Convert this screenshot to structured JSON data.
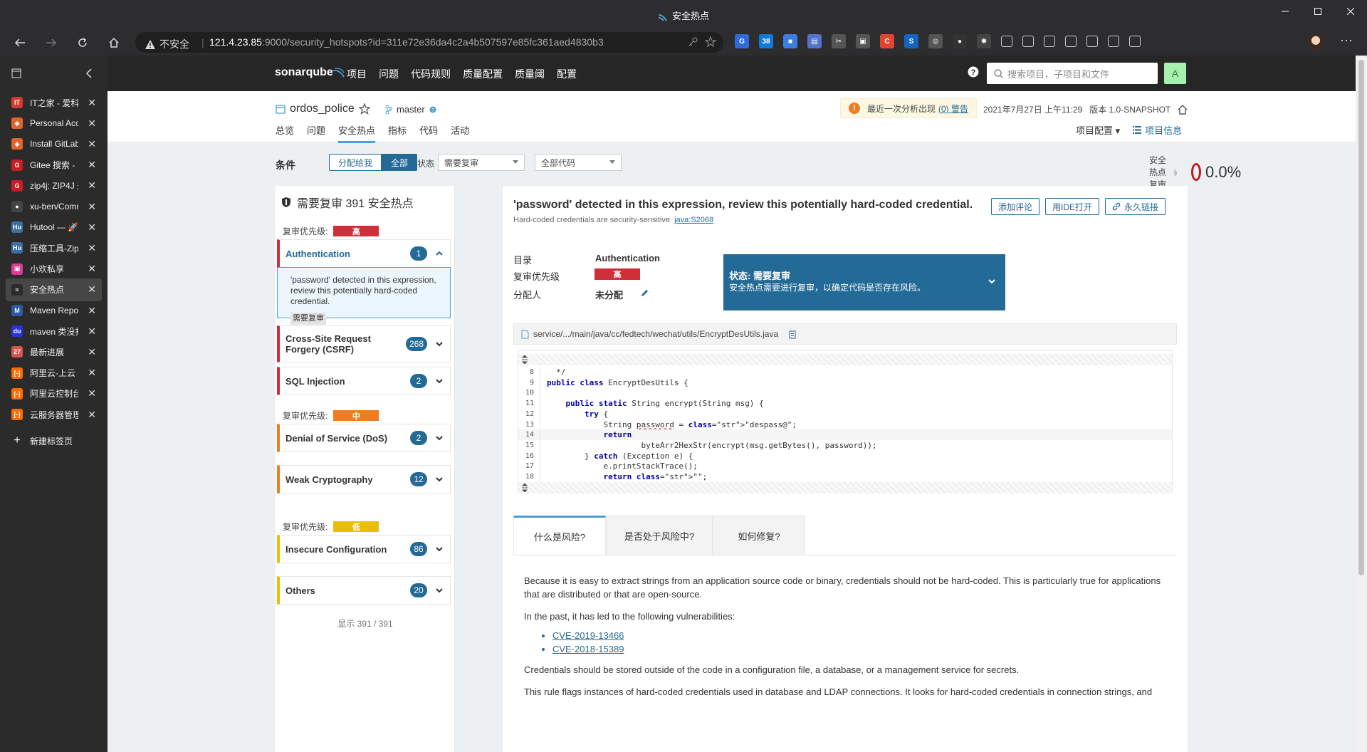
{
  "window": {
    "title": "安全热点"
  },
  "addressbar": {
    "warning": "不安全",
    "host": "121.4.23.85",
    "path": ":9000/security_hotspots?id=311e72e36da4c2a4b507597e85fc361aed4830b3"
  },
  "extensions": [
    {
      "name": "translate-ext-icon",
      "color": "#2e6bd8",
      "label": "G"
    },
    {
      "name": "clock-ext-icon",
      "color": "#0f7ad8",
      "label": "38"
    },
    {
      "name": "grid-ext-icon",
      "color": "#3b7de0",
      "label": "■"
    },
    {
      "name": "card-ext-icon",
      "color": "#5273c9",
      "label": "▤"
    },
    {
      "name": "cut-ext-icon",
      "color": "#555",
      "label": "✂"
    },
    {
      "name": "window-ext-icon",
      "color": "#555",
      "label": "▣"
    },
    {
      "name": "c-ext-icon",
      "color": "#e0462f",
      "label": "C"
    },
    {
      "name": "s-ext-icon",
      "color": "#1565c0",
      "label": "S"
    },
    {
      "name": "glasses-ext-icon",
      "color": "#555",
      "label": "◎"
    },
    {
      "name": "record-ext-icon",
      "color": "#333",
      "label": "●"
    },
    {
      "name": "puzzle-ext-icon",
      "color": "#444",
      "label": "✱"
    }
  ],
  "tabs": [
    {
      "label": "IT之家 - 爱科",
      "fav": "IT",
      "color": "#d43a2f"
    },
    {
      "label": "Personal Acce",
      "fav": "◆",
      "color": "#e2632b"
    },
    {
      "label": "Install GitLab",
      "fav": "◆",
      "color": "#e2632b"
    },
    {
      "label": "Gitee 搜索 - ",
      "fav": "G",
      "color": "#c71d23"
    },
    {
      "label": "zip4j: ZIP4J 是",
      "fav": "G",
      "color": "#c71d23"
    },
    {
      "label": "xu-ben/Comm",
      "fav": "●",
      "color": "#444"
    },
    {
      "label": "Hutool — 🚀",
      "fav": "Hu",
      "color": "#3f6ea5"
    },
    {
      "label": "压缩工具-Zip",
      "fav": "Hu",
      "color": "#3f6ea5"
    },
    {
      "label": "小欢私享",
      "fav": "▣",
      "color": "#d63f94"
    },
    {
      "label": "安全热点",
      "fav": "≈",
      "color": "#2b2b2b",
      "active": true
    },
    {
      "label": "Maven Repos",
      "fav": "M",
      "color": "#2a5aa8"
    },
    {
      "label": "maven 类没打",
      "fav": "du",
      "color": "#2932e1"
    },
    {
      "label": "最新进展",
      "fav": "27",
      "color": "#d9534f"
    },
    {
      "label": "阿里云-上云",
      "fav": "[-]",
      "color": "#ff6a00"
    },
    {
      "label": "阿里云控制台",
      "fav": "[-]",
      "color": "#ff6a00"
    },
    {
      "label": "云服务器管理",
      "fav": "[-]",
      "color": "#ff6a00"
    }
  ],
  "newtab": "新建标签页",
  "sonar": {
    "logo": "sonarqube",
    "menu": [
      "项目",
      "问题",
      "代码规则",
      "质量配置",
      "质量阈",
      "配置"
    ],
    "search_placeholder": "搜索项目，子项目和文件",
    "avatar": "A"
  },
  "project": {
    "name": "ordos_police",
    "branch": "master",
    "warning_text": "最近一次分析出现",
    "warning_link": "(0) 警告",
    "analysis_date": "2021年7月27日 上午11:29",
    "version": "版本 1.0-SNAPSHOT",
    "nav": [
      "总览",
      "问题",
      "安全热点",
      "指标",
      "代码",
      "活动"
    ],
    "config": "项目配置",
    "info": "项目信息"
  },
  "filters": {
    "label": "条件",
    "assigned_me": "分配给我",
    "all": "全部",
    "status_label": "状态",
    "status_value": "需要复审",
    "code_value": "全部代码",
    "review_label": "安全热点复审",
    "review_pct": "0.0%"
  },
  "hotspots": {
    "header": "需要复审 391 安全热点",
    "priority_label": "复审优先级:",
    "high": "高",
    "medium": "中",
    "low": "低",
    "high_color": "#d02f3a",
    "medium_color": "#ed7d20",
    "low_color": "#eabe06",
    "categories": [
      {
        "name": "Authentication",
        "count": "1"
      },
      {
        "name": "Cross-Site Request Forgery (CSRF)",
        "count": "268"
      },
      {
        "name": "SQL Injection",
        "count": "2"
      },
      {
        "name": "Denial of Service (DoS)",
        "count": "2"
      },
      {
        "name": "Weak Cryptography",
        "count": "12"
      },
      {
        "name": "Insecure Configuration",
        "count": "86"
      },
      {
        "name": "Others",
        "count": "20"
      }
    ],
    "selected_item": "'password' detected in this expression, review this potentially hard-coded credential.",
    "selected_tag": "需要复审",
    "shown": "显示 391 / 391"
  },
  "detail": {
    "title": "'password' detected in this expression, review this potentially hard-coded credential.",
    "subtitle": "Hard-coded credentials are security-sensitive",
    "rule": "java:S2068",
    "add_comment": "添加评论",
    "open_ide": "用IDE打开",
    "permalink": "永久链接",
    "category_label": "目录",
    "category_value": "Authentication",
    "priority_label": "复审优先级",
    "priority_value": "高",
    "assignee_label": "分配人",
    "assignee_value": "未分配",
    "status_title": "状态: 需要复审",
    "status_desc": "安全热点需要进行复审，以确定代码是否存在风险。",
    "file": "service/.../main/java/cc/fedtech/wechat/utils/EncryptDesUtils.java",
    "code": [
      {
        "n": "8",
        "t": "  */"
      },
      {
        "n": "9",
        "t": "public class EncryptDesUtils {"
      },
      {
        "n": "10",
        "t": ""
      },
      {
        "n": "11",
        "t": "    public static String encrypt(String msg) {"
      },
      {
        "n": "12",
        "t": "        try {"
      },
      {
        "n": "13",
        "t": "            String password = \"despass@\";"
      },
      {
        "n": "14",
        "t": "            return"
      },
      {
        "n": "15",
        "t": "                    byteArr2HexStr(encrypt(msg.getBytes(), password));"
      },
      {
        "n": "16",
        "t": "        } catch (Exception e) {"
      },
      {
        "n": "17",
        "t": "            e.printStackTrace();"
      },
      {
        "n": "18",
        "t": "            return \"\";"
      }
    ],
    "tabs": [
      "什么是风险?",
      "是否处于风险中?",
      "如何修复?"
    ],
    "risk_p1": "Because it is easy to extract strings from an application source code or binary, credentials should not be hard-coded. This is particularly true for applications that are distributed or that are open-source.",
    "risk_p2": "In the past, it has led to the following vulnerabilities:",
    "cve1": "CVE-2019-13466",
    "cve2": "CVE-2018-15389",
    "risk_p3": "Credentials should be stored outside of the code in a configuration file, a database, or a management service for secrets.",
    "risk_p4": "This rule flags instances of hard-coded credentials used in database and LDAP connections. It looks for hard-coded credentials in connection strings, and"
  }
}
